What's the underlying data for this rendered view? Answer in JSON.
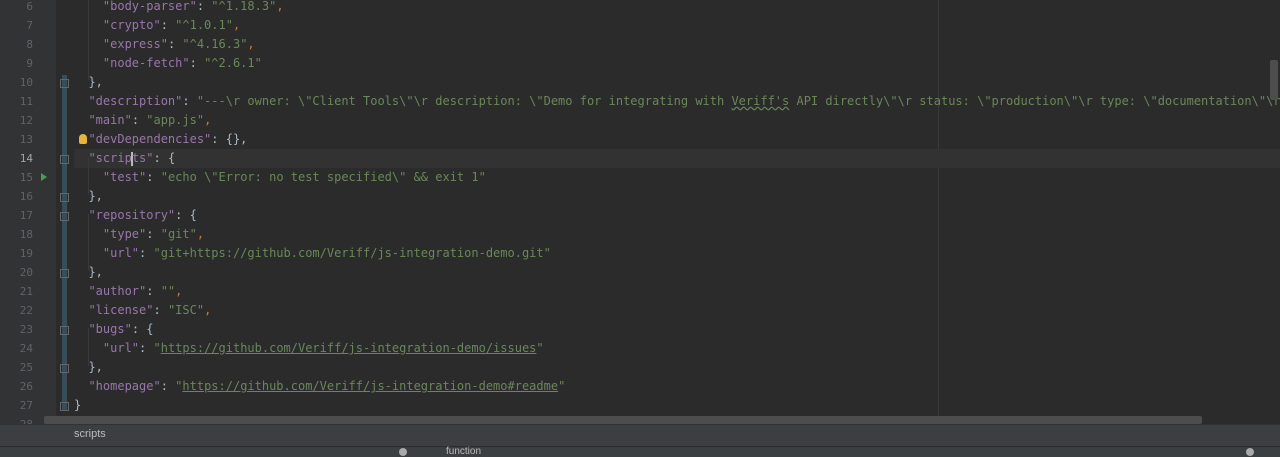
{
  "editor": {
    "lines": [
      {
        "num": "6",
        "code": [
          [
            "    ",
            "c"
          ],
          [
            "\"body-parser\"",
            "k"
          ],
          [
            ": ",
            "c"
          ],
          [
            "\"^1.18.3\"",
            "s"
          ],
          [
            ",",
            "p"
          ]
        ]
      },
      {
        "num": "7",
        "code": [
          [
            "    ",
            "c"
          ],
          [
            "\"crypto\"",
            "k"
          ],
          [
            ": ",
            "c"
          ],
          [
            "\"^1.0.1\"",
            "s"
          ],
          [
            ",",
            "p"
          ]
        ]
      },
      {
        "num": "8",
        "code": [
          [
            "    ",
            "c"
          ],
          [
            "\"express\"",
            "k"
          ],
          [
            ": ",
            "c"
          ],
          [
            "\"^4.16.3\"",
            "s"
          ],
          [
            ",",
            "p"
          ]
        ]
      },
      {
        "num": "9",
        "code": [
          [
            "    ",
            "c"
          ],
          [
            "\"node-fetch\"",
            "k"
          ],
          [
            ": ",
            "c"
          ],
          [
            "\"^2.6.1\"",
            "s"
          ]
        ]
      },
      {
        "num": "10",
        "code": [
          [
            "  },",
            "c"
          ]
        ]
      },
      {
        "num": "11",
        "code": [
          [
            "  ",
            "c"
          ],
          [
            "\"description\"",
            "k"
          ],
          [
            ": ",
            "c"
          ],
          [
            "\"---\\r owner: \\\"Client Tools\\\"\\r description: \\\"Demo for integrating with ",
            "s"
          ],
          [
            "Veriff's",
            "s typo"
          ],
          [
            " API directly\\\"\\r status: \\\"production\\\"\\r type: \\\"documentation\\\"\\r",
            "s"
          ]
        ]
      },
      {
        "num": "12",
        "code": [
          [
            "  ",
            "c"
          ],
          [
            "\"main\"",
            "k"
          ],
          [
            ": ",
            "c"
          ],
          [
            "\"app.js\"",
            "s"
          ],
          [
            ",",
            "p"
          ]
        ]
      },
      {
        "num": "13",
        "code": [
          [
            "  ",
            "c"
          ],
          [
            "\"devDependencies\"",
            "k"
          ],
          [
            ": {},",
            "c"
          ]
        ]
      },
      {
        "num": "14",
        "code": [
          [
            "  ",
            "c"
          ],
          [
            "\"scrip",
            "k"
          ],
          [
            "|caret",
            "caret"
          ],
          [
            "ts\"",
            "k"
          ],
          [
            ": {",
            "c"
          ]
        ]
      },
      {
        "num": "15",
        "code": [
          [
            "    ",
            "c"
          ],
          [
            "\"test\"",
            "k"
          ],
          [
            ": ",
            "c"
          ],
          [
            "\"echo \\\"Error: no test specified\\\" && exit 1\"",
            "s"
          ]
        ]
      },
      {
        "num": "16",
        "code": [
          [
            "  },",
            "c"
          ]
        ]
      },
      {
        "num": "17",
        "code": [
          [
            "  ",
            "c"
          ],
          [
            "\"repository\"",
            "k"
          ],
          [
            ": {",
            "c"
          ]
        ]
      },
      {
        "num": "18",
        "code": [
          [
            "    ",
            "c"
          ],
          [
            "\"type\"",
            "k"
          ],
          [
            ": ",
            "c"
          ],
          [
            "\"git\"",
            "s"
          ],
          [
            ",",
            "p"
          ]
        ]
      },
      {
        "num": "19",
        "code": [
          [
            "    ",
            "c"
          ],
          [
            "\"url\"",
            "k"
          ],
          [
            ": ",
            "c"
          ],
          [
            "\"git+https://github.com/Veriff/js-integration-demo.git\"",
            "s"
          ]
        ]
      },
      {
        "num": "20",
        "code": [
          [
            "  },",
            "c"
          ]
        ]
      },
      {
        "num": "21",
        "code": [
          [
            "  ",
            "c"
          ],
          [
            "\"author\"",
            "k"
          ],
          [
            ": ",
            "c"
          ],
          [
            "\"\"",
            "s"
          ],
          [
            ",",
            "p"
          ]
        ]
      },
      {
        "num": "22",
        "code": [
          [
            "  ",
            "c"
          ],
          [
            "\"license\"",
            "k"
          ],
          [
            ": ",
            "c"
          ],
          [
            "\"ISC\"",
            "s"
          ],
          [
            ",",
            "p"
          ]
        ]
      },
      {
        "num": "23",
        "code": [
          [
            "  ",
            "c"
          ],
          [
            "\"bugs\"",
            "k"
          ],
          [
            ": {",
            "c"
          ]
        ]
      },
      {
        "num": "24",
        "code": [
          [
            "    ",
            "c"
          ],
          [
            "\"url\"",
            "k"
          ],
          [
            ": ",
            "c"
          ],
          [
            "\"",
            "s"
          ],
          [
            "https://github.com/Veriff/js-integration-demo/issues",
            "url"
          ],
          [
            "\"",
            "s"
          ]
        ]
      },
      {
        "num": "25",
        "code": [
          [
            "  },",
            "c"
          ]
        ]
      },
      {
        "num": "26",
        "code": [
          [
            "  ",
            "c"
          ],
          [
            "\"homepage\"",
            "k"
          ],
          [
            ": ",
            "c"
          ],
          [
            "\"",
            "s"
          ],
          [
            "https://github.com/Veriff/js-integration-demo#readme",
            "url"
          ],
          [
            "\"",
            "s"
          ]
        ]
      },
      {
        "num": "27",
        "code": [
          [
            "}",
            "c"
          ]
        ]
      },
      {
        "num": "28",
        "code": [
          [
            "",
            "c"
          ]
        ]
      }
    ],
    "current_line_num": "14"
  },
  "breadcrumb": {
    "item": "scripts"
  },
  "bottom": {
    "text": "function"
  },
  "colors": {
    "background": "#2b2b2b",
    "gutter": "#313335",
    "key": "#9876aa",
    "string": "#6a8759",
    "punct": "#cc7832"
  }
}
